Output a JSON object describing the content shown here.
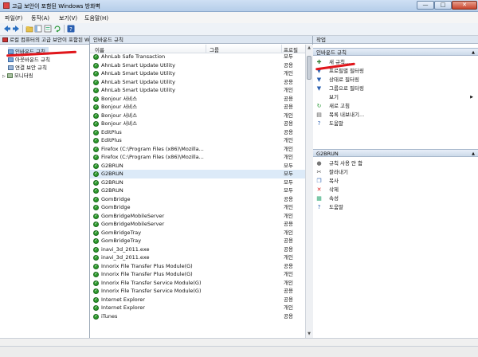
{
  "window": {
    "title": "고급 보안이 포함된 Windows 방화벽",
    "min": "—",
    "max": "□",
    "close": "✕"
  },
  "menu": [
    "파일(F)",
    "동작(A)",
    "보기(V)",
    "도움말(H)"
  ],
  "toolbar_icons": [
    "back-icon",
    "forward-icon",
    "up-folder-icon",
    "show-hide-tree-icon",
    "properties-icon",
    "refresh-icon",
    "help-icon"
  ],
  "tree": {
    "root": "로컬 컴퓨터의 고급 보안이 포함된 Windows 방화벽",
    "items": [
      "인바운드 규칙",
      "아웃바운드 규칙",
      "연결 보안 규칙",
      "모니터링"
    ]
  },
  "middle": {
    "header": "인바운드 규칙",
    "columns": [
      "이름",
      "그룹",
      "프로필"
    ],
    "rows": [
      {
        "name": "AhnLab Safe Transaction",
        "profile": "모두"
      },
      {
        "name": "AhnLab Smart Update Utility",
        "profile": "공용"
      },
      {
        "name": "AhnLab Smart Update Utility",
        "profile": "개인"
      },
      {
        "name": "AhnLab Smart Update Utility",
        "profile": "공용"
      },
      {
        "name": "AhnLab Smart Update Utility",
        "profile": "개인"
      },
      {
        "name": "Bonjour 서비스",
        "profile": "공용"
      },
      {
        "name": "Bonjour 서비스",
        "profile": "공용"
      },
      {
        "name": "Bonjour 서비스",
        "profile": "개인"
      },
      {
        "name": "Bonjour 서비스",
        "profile": "공용"
      },
      {
        "name": "EditPlus",
        "profile": "공용"
      },
      {
        "name": "EditPlus",
        "profile": "개인"
      },
      {
        "name": "Firefox (C:\\Program Files (x86)\\Mozilla...",
        "profile": "개인"
      },
      {
        "name": "Firefox (C:\\Program Files (x86)\\Mozilla...",
        "profile": "개인"
      },
      {
        "name": "G2BRUN",
        "profile": "모두"
      },
      {
        "name": "G2BRUN",
        "profile": "모두"
      },
      {
        "name": "G2BRUN",
        "profile": "모두"
      },
      {
        "name": "G2BRUN",
        "profile": "모두"
      },
      {
        "name": "GomBridge",
        "profile": "공용"
      },
      {
        "name": "GomBridge",
        "profile": "개인"
      },
      {
        "name": "GomBridgeMobileServer",
        "profile": "개인"
      },
      {
        "name": "GomBridgeMobileServer",
        "profile": "공용"
      },
      {
        "name": "GomBridgeTray",
        "profile": "개인"
      },
      {
        "name": "GomBridgeTray",
        "profile": "공용"
      },
      {
        "name": "inavi_3d_2011.exe",
        "profile": "공용"
      },
      {
        "name": "inavi_3d_2011.exe",
        "profile": "개인"
      },
      {
        "name": "Innorix File Transfer Plus Module(G)",
        "profile": "공용"
      },
      {
        "name": "Innorix File Transfer Plus Module(G)",
        "profile": "개인"
      },
      {
        "name": "Innorix File Transfer Service Module(G)",
        "profile": "개인"
      },
      {
        "name": "Innorix File Transfer Service Module(G)",
        "profile": "공용"
      },
      {
        "name": "Internet Explorer",
        "profile": "공용"
      },
      {
        "name": "Internet Explorer",
        "profile": "개인"
      },
      {
        "name": "iTunes",
        "profile": "공용"
      }
    ]
  },
  "actions": {
    "header": "작업",
    "section1": "인바운드 규칙",
    "section1_items": [
      {
        "label": "새 규칙...",
        "icon": "new-rule-icon"
      },
      {
        "label": "프로필별 필터링",
        "icon": "filter-icon"
      },
      {
        "label": "상태로 필터링",
        "icon": "filter-icon"
      },
      {
        "label": "그룹으로 필터링",
        "icon": "filter-icon"
      },
      {
        "label": "보기",
        "icon": ""
      },
      {
        "label": "새로 고침",
        "icon": "refresh-icon"
      },
      {
        "label": "목록 내보내기...",
        "icon": "export-icon"
      },
      {
        "label": "도움말",
        "icon": "help-icon"
      }
    ],
    "section2": "G2BRUN",
    "section2_items": [
      {
        "label": "규칙 사용 안 함",
        "icon": "disable-icon"
      },
      {
        "label": "잘라내기",
        "icon": "cut-icon"
      },
      {
        "label": "복사",
        "icon": "copy-icon"
      },
      {
        "label": "삭제",
        "icon": "delete-icon"
      },
      {
        "label": "속성",
        "icon": "properties-icon"
      },
      {
        "label": "도움말",
        "icon": "help-icon"
      }
    ]
  },
  "colors": {
    "accent": "#e0161b",
    "enabled": "#2e9a2e",
    "header": "#dde6f1"
  }
}
